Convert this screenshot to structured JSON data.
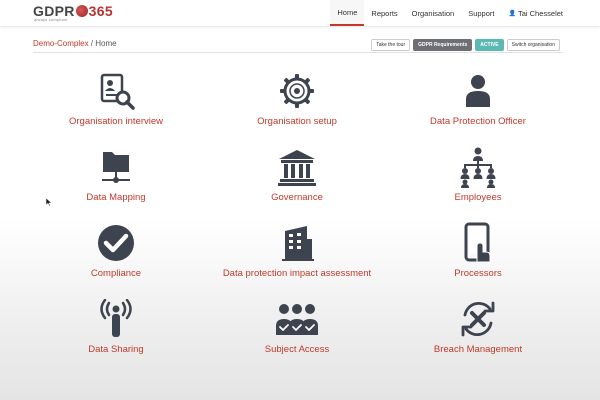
{
  "brand": {
    "logo_text": "GDPR",
    "logo_num": "365",
    "tagline": "always compliant",
    "accent": "#c0392b"
  },
  "nav": {
    "items": [
      {
        "label": "Home",
        "active": true
      },
      {
        "label": "Reports",
        "active": false
      },
      {
        "label": "Organisation",
        "active": false
      },
      {
        "label": "Support",
        "active": false
      }
    ],
    "user": "Tai Chesselet"
  },
  "breadcrumb": {
    "org": "Demo-Complex",
    "separator": " / ",
    "page": "Home"
  },
  "actions": {
    "take_tour": "Take the tour",
    "gdpr_requirements": "GDPR Requirements",
    "status": "ACTIVE",
    "switch_org": "Switch organisation"
  },
  "modules": [
    {
      "label": "Organisation interview",
      "icon": "interview-search-icon"
    },
    {
      "label": "Organisation setup",
      "icon": "gear-icon"
    },
    {
      "label": "Data Protection Officer",
      "icon": "person-icon"
    },
    {
      "label": "Data Mapping",
      "icon": "folder-network-icon"
    },
    {
      "label": "Governance",
      "icon": "building-columns-icon"
    },
    {
      "label": "Employees",
      "icon": "org-chart-icon"
    },
    {
      "label": "Compliance",
      "icon": "checkmark-circle-icon"
    },
    {
      "label": "Data protection impact assessment",
      "icon": "building-icon"
    },
    {
      "label": "Processors",
      "icon": "tablet-touch-icon"
    },
    {
      "label": "Data Sharing",
      "icon": "antenna-icon"
    },
    {
      "label": "Subject Access",
      "icon": "users-check-icon"
    },
    {
      "label": "Breach Management",
      "icon": "sync-x-icon"
    }
  ]
}
